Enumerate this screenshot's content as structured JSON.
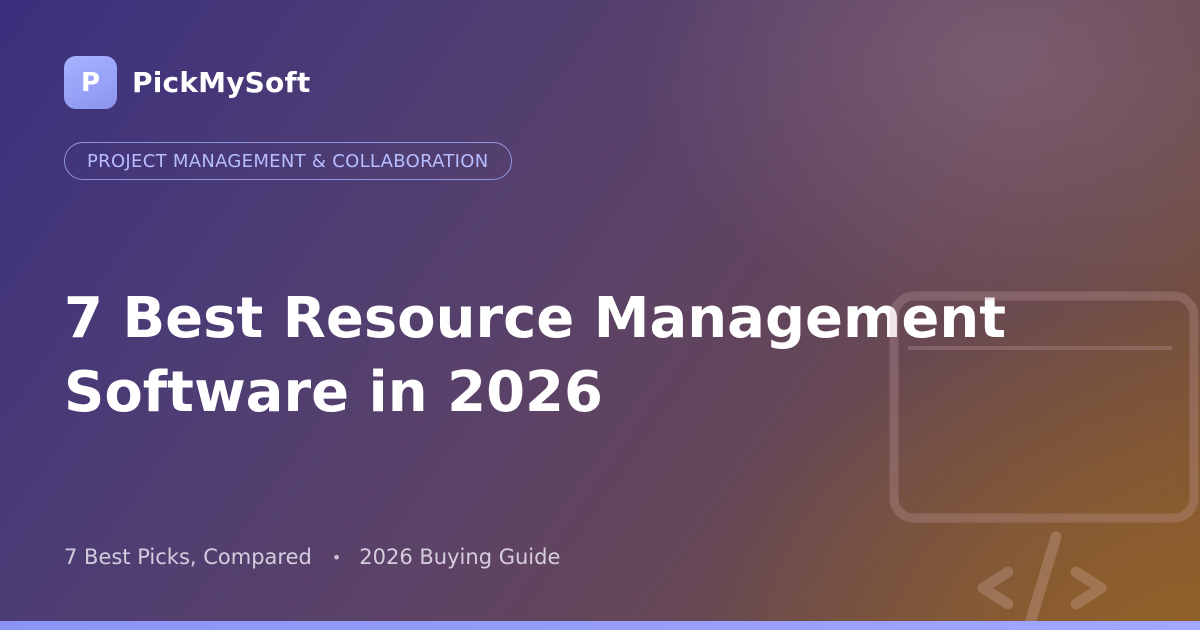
{
  "brand": {
    "logo_letter": "P",
    "name": "PickMySoft"
  },
  "category": "PROJECT MANAGEMENT & COLLABORATION",
  "title": {
    "line1": "7 Best Resource Management",
    "line2": "Software in 2026"
  },
  "subline": {
    "part1": "7 Best Picks, Compared",
    "separator": "•",
    "part2": "2026 Buying Guide"
  },
  "decoration": {
    "icon": "code-window-icon",
    "glyph": "</>"
  },
  "colors": {
    "accent": "#a0a8ff",
    "title": "#ffffff",
    "pill_text": "#b7bdff"
  }
}
